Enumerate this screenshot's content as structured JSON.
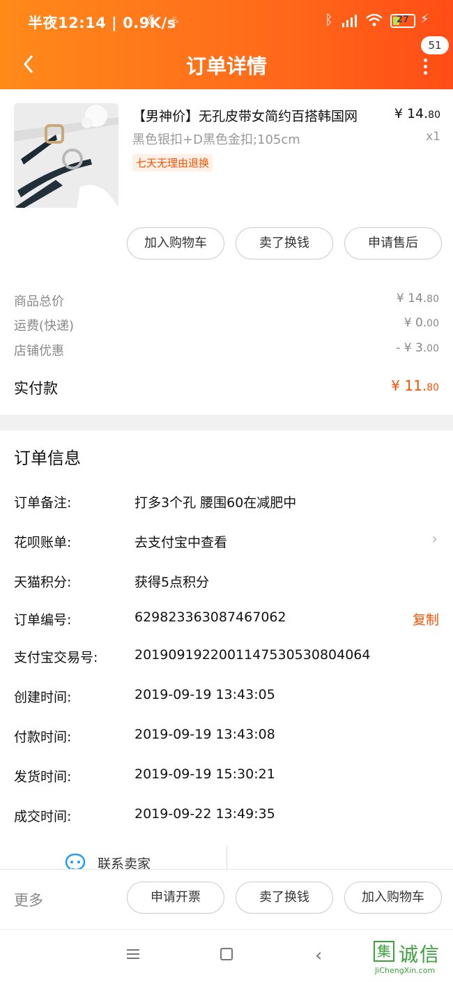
{
  "status_bar": {
    "time": "半夜12:14 | 0.9K/s",
    "battery": "27",
    "battery_level": 0.27
  },
  "nav": {
    "title": "订单详情",
    "badge": "51"
  },
  "product": {
    "title": "【男神价】无孔皮带女简约百搭韩国网",
    "price": "¥ 14.",
    "price_decimal": "80",
    "sku": "黑色银扣+D黑色金扣;105cm",
    "qty": "x1",
    "tag": "七天无理由退换"
  },
  "item_actions": [
    "加入购物车",
    "卖了换钱",
    "申请售后"
  ],
  "summary": [
    {
      "label": "商品总价",
      "value": "¥ 14.",
      "dec": "80"
    },
    {
      "label": "运费(快递)",
      "value": "¥ 0.",
      "dec": "00"
    },
    {
      "label": "店铺优惠",
      "value": "- ¥ 3.",
      "dec": "00"
    }
  ],
  "paid": {
    "label": "实付款",
    "value": "¥ 11.",
    "dec": "80"
  },
  "order_info": {
    "title": "订单信息",
    "rows": [
      {
        "label": "订单备注:",
        "value": "打多3个孔 腰围60在减肥中"
      },
      {
        "label": "花呗账单:",
        "value": "去支付宝中查看"
      },
      {
        "label": "天猫积分:",
        "value": "获得5点积分"
      },
      {
        "label": "订单编号:",
        "value": "629823363087467062",
        "action": "复制"
      },
      {
        "label": "支付宝交易号:",
        "value": "2019091922001147530530804064"
      },
      {
        "label": "创建时间:",
        "value": "2019-09-19 13:43:05"
      },
      {
        "label": "付款时间:",
        "value": "2019-09-19 13:43:08"
      },
      {
        "label": "发货时间:",
        "value": "2019-09-19 15:30:21"
      },
      {
        "label": "成交时间:",
        "value": "2019-09-22 13:49:35"
      }
    ]
  },
  "contact": {
    "label": "联系卖家"
  },
  "bottom_bar": {
    "more": "更多",
    "buttons": [
      "申请开票",
      "卖了换钱",
      "加入购物车"
    ]
  },
  "watermark": {
    "icon_char": "集",
    "cn": "诚信",
    "en": "JiChengXin.com"
  },
  "colors": {
    "accent": "#ff5000",
    "header_start": "#ff8a1a",
    "header_end": "#ff4d17"
  }
}
